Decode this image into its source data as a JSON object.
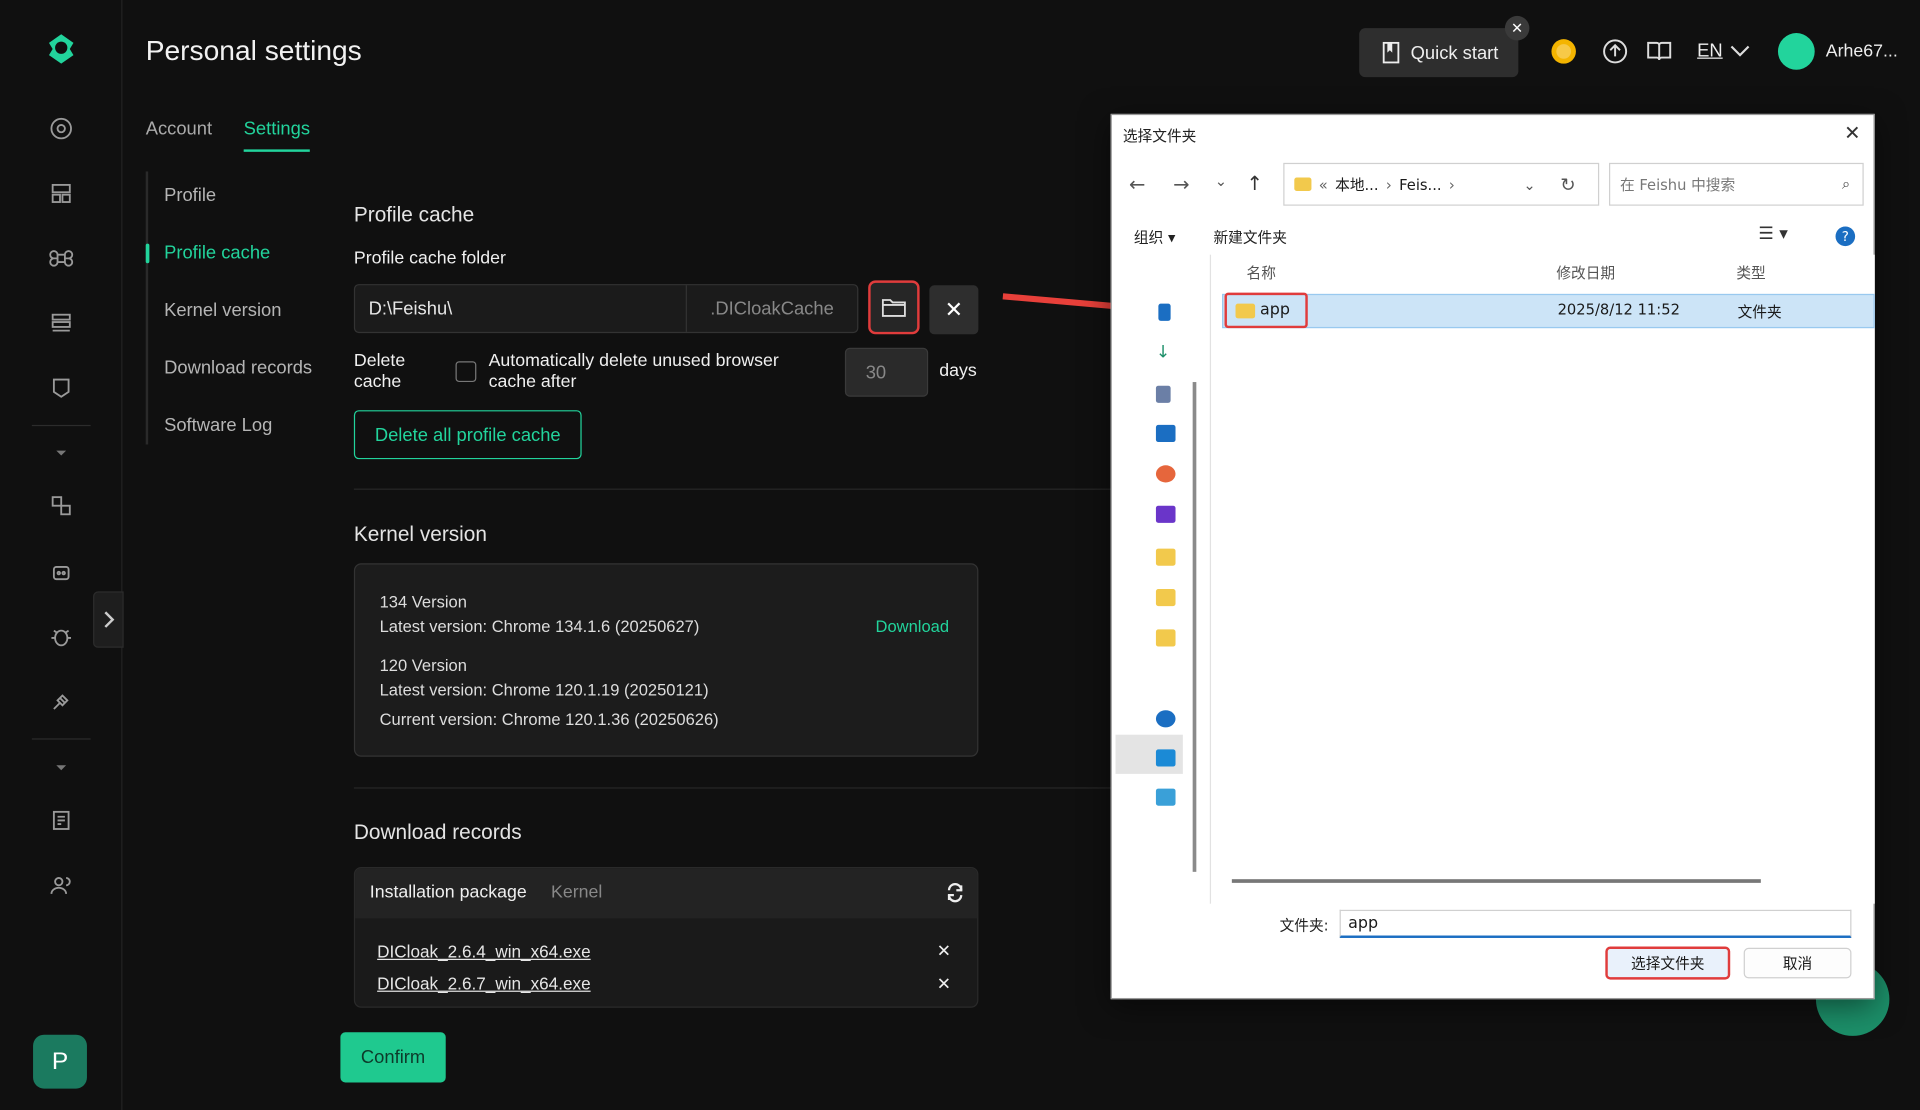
{
  "app": {
    "title": "Personal settings",
    "avatar_letter": "P"
  },
  "tabs": [
    {
      "label": "Account"
    },
    {
      "label": "Settings"
    }
  ],
  "subnav": [
    "Profile",
    "Profile cache",
    "Kernel version",
    "Download records",
    "Software Log"
  ],
  "header": {
    "quick_start": "Quick start",
    "lang": "EN",
    "user": "Arhe67..."
  },
  "profile_cache": {
    "heading": "Profile cache",
    "folder_label": "Profile cache folder",
    "folder_value": "D:\\Feishu\\",
    "folder_suffix": ".DICloakCache",
    "delete_label_line1": "Delete",
    "delete_label_line2": "cache",
    "auto_delete_line1": "Automatically delete unused browser",
    "auto_delete_line2": "cache after",
    "days_value": "30",
    "days_unit": "days",
    "delete_all": "Delete all profile cache"
  },
  "kernel": {
    "heading": "Kernel version",
    "v134_title": "134 Version",
    "v134_latest": "Latest version: Chrome 134.1.6 (20250627)",
    "download": "Download",
    "v120_title": "120 Version",
    "v120_latest": "Latest version: Chrome 120.1.19 (20250121)",
    "v120_current": "Current version: Chrome 120.1.36 (20250626)"
  },
  "downloads": {
    "heading": "Download records",
    "tab_pkg": "Installation package",
    "tab_kernel": "Kernel",
    "files": [
      "DICloak_2.6.4_win_x64.exe",
      "DICloak_2.6.7_win_x64.exe"
    ]
  },
  "confirm": "Confirm",
  "dialog": {
    "title": "选择文件夹",
    "breadcrumb_1": "本地...",
    "breadcrumb_2": "Feis...",
    "search_placeholder": "在 Feishu 中搜索",
    "organize": "组织",
    "new_folder": "新建文件夹",
    "col_name": "名称",
    "col_date": "修改日期",
    "col_type": "类型",
    "row_name": "app",
    "row_date": "2025/8/12 11:52",
    "row_type": "文件夹",
    "folder_label": "文件夹:",
    "folder_value": "app",
    "select_btn": "选择文件夹",
    "cancel_btn": "取消"
  },
  "colors": {
    "accent": "#22d49c",
    "highlight": "#e03c3c",
    "bg": "#101010"
  }
}
